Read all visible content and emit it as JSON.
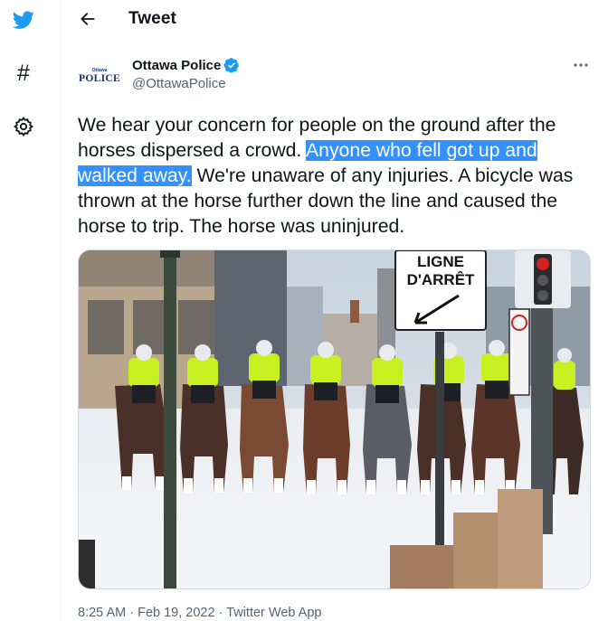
{
  "nav": {
    "items": [
      {
        "icon": "twitter-bird-icon"
      },
      {
        "icon": "hashtag-icon",
        "glyph": "#"
      },
      {
        "icon": "gear-icon"
      }
    ]
  },
  "header": {
    "back_icon": "back-arrow-icon",
    "title": "Tweet"
  },
  "tweet": {
    "author": {
      "name": "Ottawa Police",
      "handle": "@OttawaPolice",
      "avatar_top": "Ottawa",
      "avatar_main": "POLICE",
      "verified": true
    },
    "more_icon": "more-horizontal-icon",
    "text_before": "We hear your concern for people on the ground after the horses dispersed a crowd. ",
    "text_highlight": "Anyone who fell got up and walked away.",
    "text_after": " We're unaware of any injuries. A bicycle was thrown at the horse further down the line and caused the horse to trip. The horse was uninjured.",
    "photo": {
      "sign_line1": "LIGNE",
      "sign_line2": "D'ARRÊT"
    },
    "meta": "8:25 AM · Feb 19, 2022 · Twitter Web App"
  },
  "colors": {
    "accent": "#1d9bf0",
    "highlight": "#3390ff",
    "muted": "#536471",
    "vest": "#c8f020"
  }
}
